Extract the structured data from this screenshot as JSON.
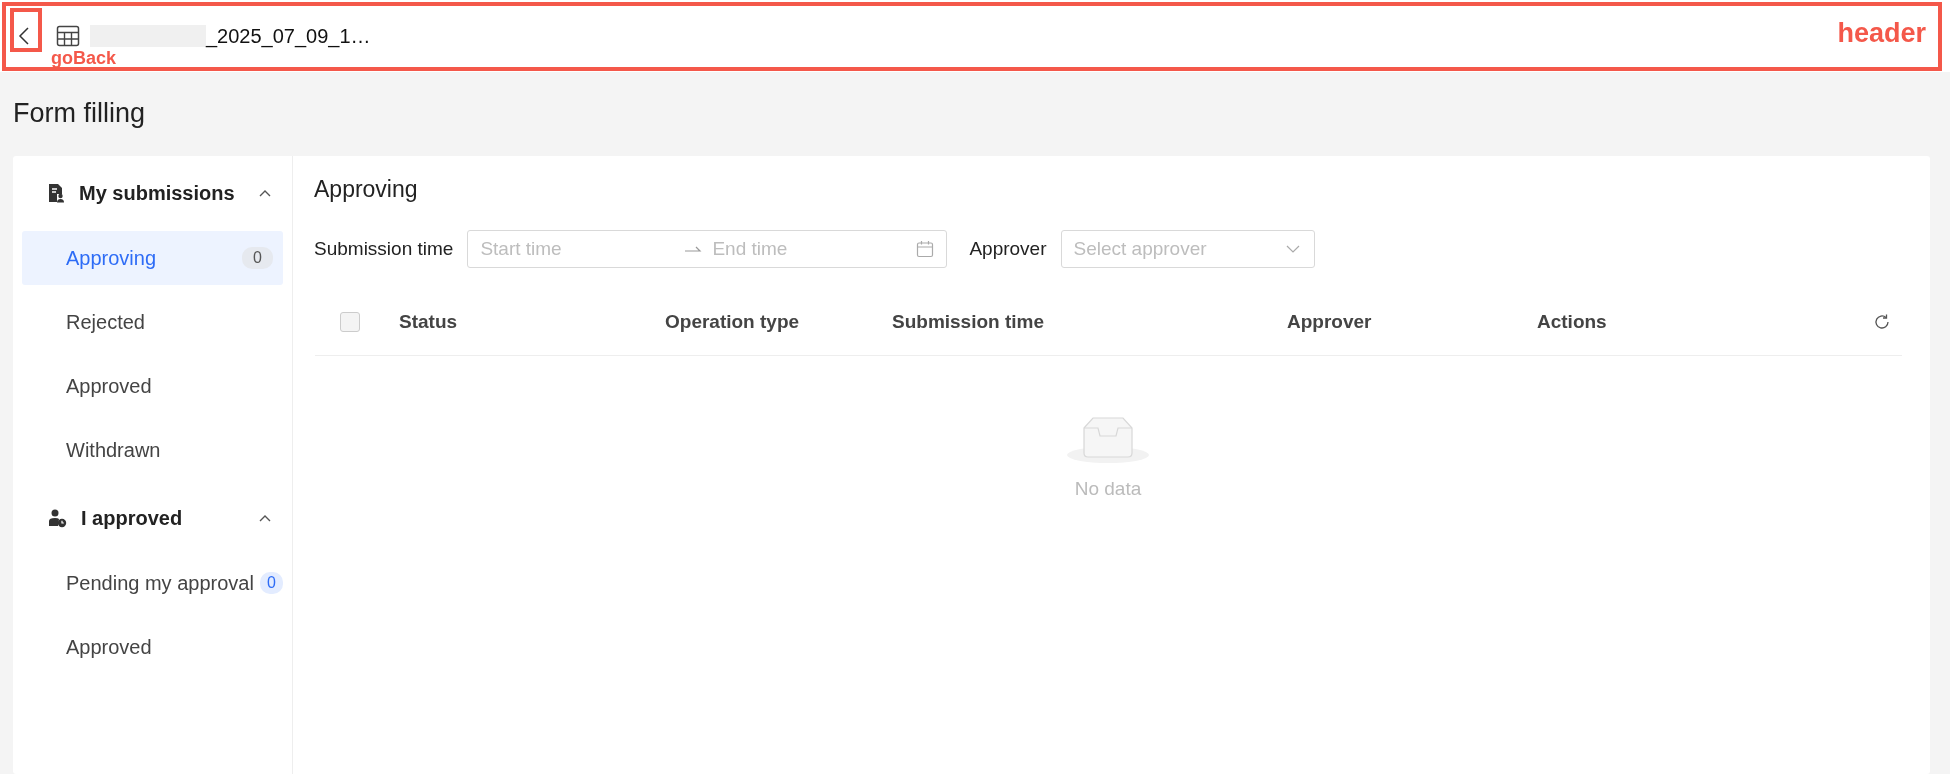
{
  "header": {
    "title": "_2025_07_09_1…",
    "annotation_labels": {
      "header": "header",
      "back": "goBack"
    }
  },
  "page_title": "Form filling",
  "sidebar": {
    "groups": [
      {
        "kind": "document",
        "title": "My submissions",
        "expanded": true,
        "items": [
          {
            "label": "Approving",
            "count": "0",
            "selected": true
          },
          {
            "label": "Rejected",
            "selected": false
          },
          {
            "label": "Approved",
            "selected": false
          },
          {
            "label": "Withdrawn",
            "selected": false
          }
        ]
      },
      {
        "kind": "stamp",
        "title": "I approved",
        "expanded": true,
        "items": [
          {
            "label": "Pending my approval",
            "count": "0",
            "selected": false
          },
          {
            "label": "Approved",
            "selected": false
          }
        ]
      }
    ]
  },
  "main": {
    "title": "Approving",
    "filters": {
      "time": {
        "label": "Submission time",
        "start_placeholder": "Start time",
        "end_placeholder": "End time"
      },
      "approver": {
        "label": "Approver",
        "placeholder": "Select approver"
      }
    },
    "table": {
      "select_all": {
        "checked": false
      },
      "columns": [
        "Status",
        "Operation type",
        "Submission time",
        "Approver",
        "Actions"
      ],
      "empty_text": "No data"
    }
  }
}
